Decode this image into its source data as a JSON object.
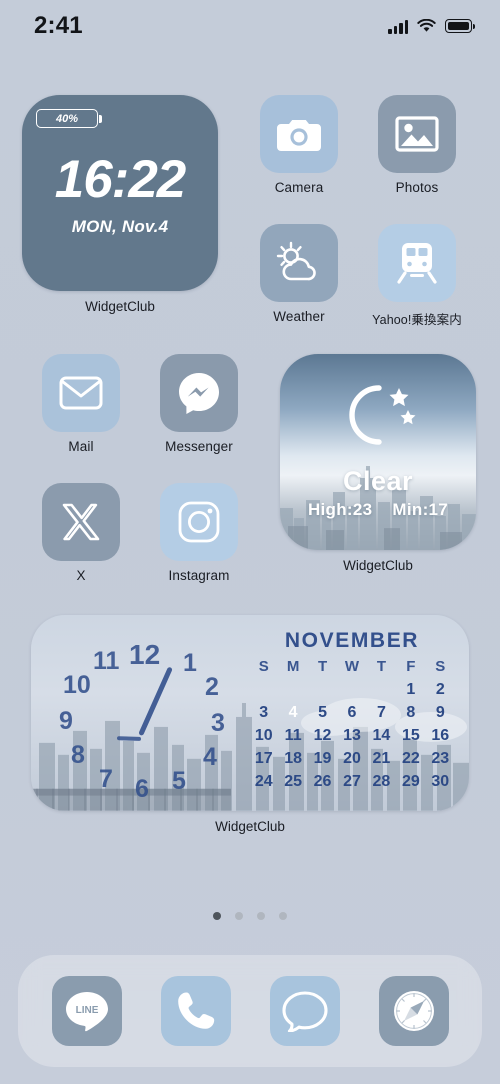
{
  "status_bar": {
    "time": "2:41",
    "signal_icon": "cellular-bars-icon",
    "wifi_icon": "wifi-icon",
    "battery_icon": "battery-icon"
  },
  "clock_widget": {
    "battery_percent": "40%",
    "time": "16:22",
    "date": "MON, Nov.4",
    "label": "WidgetClub",
    "background_color": "#62788c"
  },
  "weather_widget": {
    "icon": "crescent-moon-stars-icon",
    "condition": "Clear",
    "high": "High:23",
    "min": "Min:17",
    "label": "WidgetClub"
  },
  "calendar_widget": {
    "label": "WidgetClub",
    "month": "NOVEMBER",
    "day_headers": [
      "S",
      "M",
      "T",
      "W",
      "T",
      "F",
      "S"
    ],
    "leading_blanks": 5,
    "days": [
      1,
      2,
      3,
      4,
      5,
      6,
      7,
      8,
      9,
      10,
      11,
      12,
      13,
      14,
      15,
      16,
      17,
      18,
      19,
      20,
      21,
      22,
      23,
      24,
      25,
      26,
      27,
      28,
      29,
      30
    ],
    "today": 4,
    "accent_color": "#2e55a3",
    "analog_numerals": [
      "1",
      "2",
      "3",
      "4",
      "5",
      "6",
      "7",
      "8",
      "9",
      "10",
      "11",
      "12"
    ]
  },
  "apps": [
    {
      "name": "Camera",
      "icon": "camera-icon",
      "bg": "#a7c0da"
    },
    {
      "name": "Photos",
      "icon": "photos-icon",
      "bg": "#8b9bad"
    },
    {
      "name": "Weather",
      "icon": "weather-icon",
      "bg": "#92a6bb"
    },
    {
      "name": "Yahoo!乗換案内",
      "icon": "train-icon",
      "bg": "#b4cde5"
    },
    {
      "name": "Mail",
      "icon": "mail-icon",
      "bg": "#aac2da"
    },
    {
      "name": "Messenger",
      "icon": "messenger-icon",
      "bg": "#8a9aac"
    },
    {
      "name": "X",
      "icon": "x-icon",
      "bg": "#8b9bad"
    },
    {
      "name": "Instagram",
      "icon": "instagram-icon",
      "bg": "#b4cde5"
    }
  ],
  "dock": [
    {
      "name": "LINE",
      "icon": "line-icon",
      "bg": "#8a9cae",
      "glyph_text": "LINE"
    },
    {
      "name": "Phone",
      "icon": "phone-icon",
      "bg": "#a8c4dd"
    },
    {
      "name": "Messages",
      "icon": "messages-icon",
      "bg": "#a8c4dd"
    },
    {
      "name": "Safari",
      "icon": "safari-icon",
      "bg": "#8a9cae"
    }
  ],
  "page_dots": {
    "count": 4,
    "active_index": 0
  }
}
